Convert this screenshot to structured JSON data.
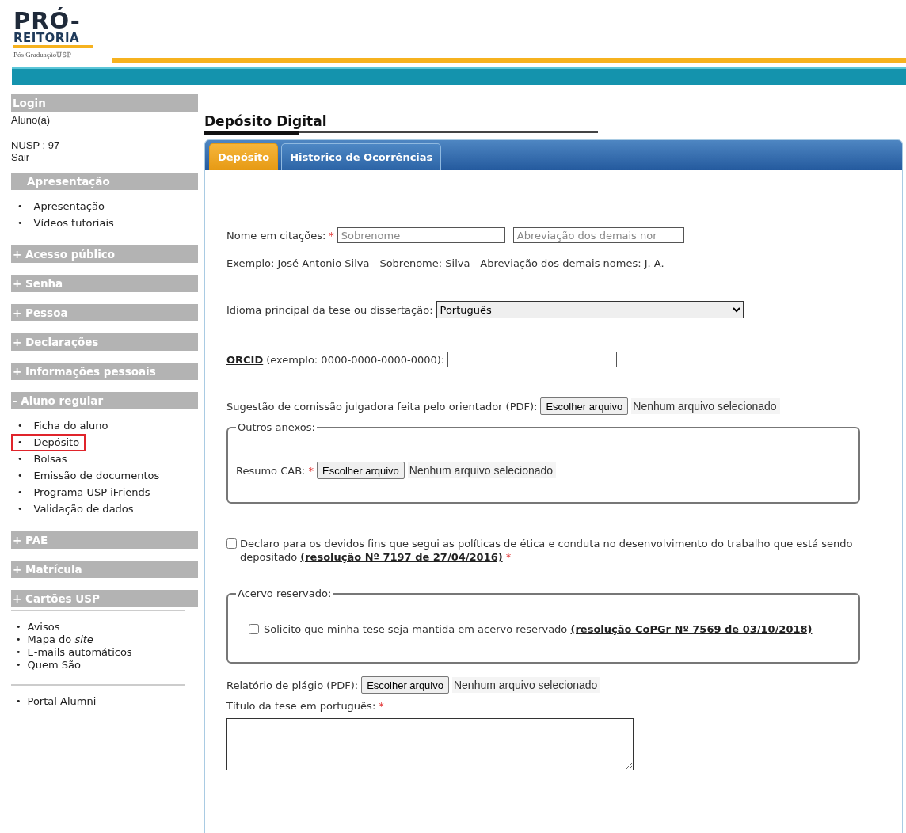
{
  "header": {
    "logo": {
      "line1": "PRÓ-",
      "line2": "REITORIA",
      "line3": "Pós Graduação",
      "line4": "USP"
    }
  },
  "sidebar": {
    "login": {
      "title": "Login",
      "role": "Aluno(a)",
      "nusp": "NUSP : 97",
      "logout": "Sair"
    },
    "sections": [
      {
        "title": "Apresentação",
        "items": [
          {
            "bullet": "•",
            "label": "Apresentação"
          },
          {
            "bullet": "•",
            "label": "Vídeos tutoriais"
          }
        ]
      },
      {
        "title": "+ Acesso público"
      },
      {
        "title": "+ Senha"
      },
      {
        "title": "+ Pessoa"
      },
      {
        "title": "+ Declarações"
      },
      {
        "title": "+ Informações pessoais"
      },
      {
        "title": "- Aluno regular",
        "items": [
          {
            "bullet": "•",
            "label": "Ficha do aluno",
            "selected": false
          },
          {
            "bullet": "•",
            "label": "Depósito",
            "selected": true
          },
          {
            "bullet": "•",
            "label": "Bolsas",
            "selected": false
          },
          {
            "bullet": "•",
            "label": "Emissão de documentos",
            "selected": false
          },
          {
            "bullet": "•",
            "label": "Programa USP iFriends",
            "selected": false
          },
          {
            "bullet": "•",
            "label": "Validação de dados",
            "selected": false
          }
        ]
      },
      {
        "title": "+ PAE"
      },
      {
        "title": "+ Matrícula"
      },
      {
        "title": "+ Cartões USP"
      }
    ],
    "links": [
      {
        "bullet": "•",
        "label": "Avisos"
      },
      {
        "bullet": "•",
        "label": "Mapa do *site*"
      },
      {
        "bullet": "•",
        "label": "E-mails automáticos"
      },
      {
        "bullet": "•",
        "label": "Quem São"
      }
    ],
    "extra_links": [
      {
        "bullet": "•",
        "label": "Portal Alumni"
      }
    ]
  },
  "main": {
    "title": "Depósito Digital",
    "tabs": [
      {
        "label": "Depósito",
        "selected": true
      },
      {
        "label": "Historico de Ocorrências",
        "selected": false
      }
    ],
    "form": {
      "citation": {
        "label": "Nome em citações:",
        "required": "*",
        "placeholders": [
          "Sobrenome",
          "Abreviação dos demais nor"
        ]
      },
      "example": "Exemplo: José Antonio Silva - Sobrenome: Silva - Abreviação dos demais nomes: J. A.",
      "language": {
        "label": "Idioma principal da tese ou dissertação:",
        "value": "Português"
      },
      "orcid": {
        "link": "ORCID",
        "hint": "(exemplo: 0000-0000-0000-0000):"
      },
      "committee_file": {
        "label": "Sugestão de comissão julgadora feita pelo orientador (PDF):",
        "button": "Escolher arquivo",
        "status": "Nenhum arquivo selecionado"
      },
      "other_attachments": {
        "legend": "Outros anexos:",
        "label": "Resumo CAB:",
        "required": "*",
        "button": "Escolher arquivo",
        "status": "Nenhum arquivo selecionado"
      },
      "ethics": {
        "checked": false,
        "text": "Declaro para os devidos fins que segui as políticas de ética e conduta no desenvolvimento do trabalho que está sendo depositado",
        "link": "(resolução Nº 7197 de 27/04/2016)",
        "required": "*"
      },
      "reserved": {
        "legend": "Acervo reservado:",
        "checked": false,
        "text": "Solicito que minha tese seja mantida em acervo reservado",
        "link": "(resolução CoPGr Nº 7569 de 03/10/2018)"
      },
      "plagiarism": {
        "label": "Relatório de plágio (PDF):",
        "button": "Escolher arquivo",
        "status": "Nenhum arquivo selecionado"
      },
      "title_pt": {
        "label": "Título da tese em português:",
        "required": "*"
      }
    }
  }
}
